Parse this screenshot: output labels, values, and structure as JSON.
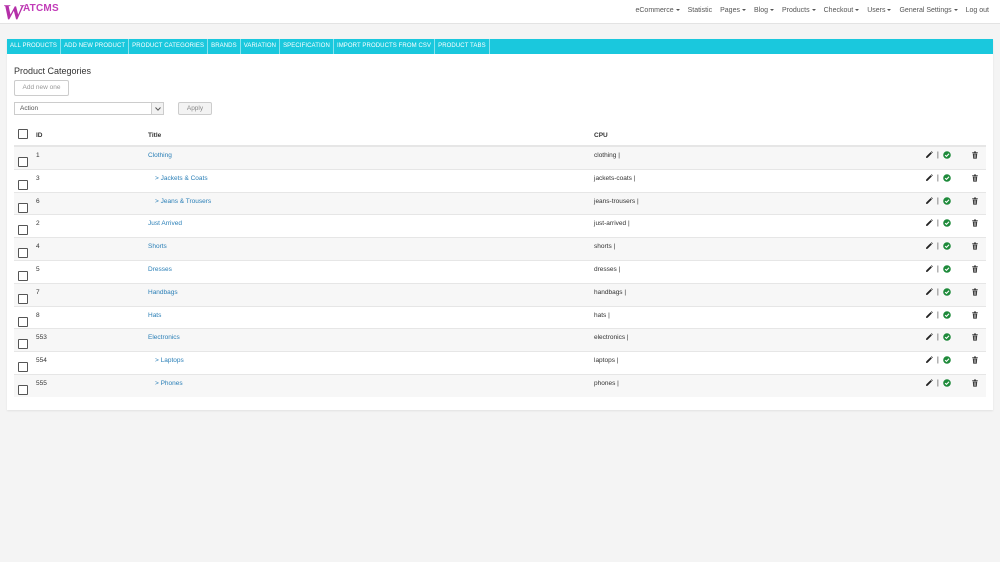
{
  "logo": {
    "letter": "W",
    "rest": "ATCMS"
  },
  "topnav": [
    {
      "label": "eCommerce",
      "caret": true
    },
    {
      "label": "Statistic",
      "caret": false
    },
    {
      "label": "Pages",
      "caret": true
    },
    {
      "label": "Blog",
      "caret": true
    },
    {
      "label": "Products",
      "caret": true
    },
    {
      "label": "Checkout",
      "caret": true
    },
    {
      "label": "Users",
      "caret": true
    },
    {
      "label": "General Settings",
      "caret": true
    },
    {
      "label": "Log out",
      "caret": false
    }
  ],
  "tabs": [
    "ALL PRODUCTS",
    "ADD NEW PRODUCT",
    "PRODUCT CATEGORIES",
    "BRANDS",
    "VARIATION",
    "SPECIFICATION",
    "IMPORT PRODUCTS FROM CSV",
    "PRODUCT TABS"
  ],
  "page": {
    "title": "Product Categories",
    "add_button": "Add new one",
    "action_select": "Action",
    "apply_button": "Apply"
  },
  "table": {
    "columns": {
      "id": "ID",
      "title": "Title",
      "cpu": "CPU"
    },
    "rows": [
      {
        "id": "1",
        "title": "Clothing",
        "child": false,
        "cpu": "clothing |"
      },
      {
        "id": "3",
        "title": "> Jackets & Coats",
        "child": true,
        "cpu": "jackets-coats |"
      },
      {
        "id": "6",
        "title": "> Jeans & Trousers",
        "child": true,
        "cpu": "jeans-trousers |"
      },
      {
        "id": "2",
        "title": "Just Arrived",
        "child": false,
        "cpu": "just-arrived |"
      },
      {
        "id": "4",
        "title": "Shorts",
        "child": false,
        "cpu": "shorts |"
      },
      {
        "id": "5",
        "title": "Dresses",
        "child": false,
        "cpu": "dresses |"
      },
      {
        "id": "7",
        "title": "Handbags",
        "child": false,
        "cpu": "handbags |"
      },
      {
        "id": "8",
        "title": "Hats",
        "child": false,
        "cpu": "hats |"
      },
      {
        "id": "553",
        "title": "Electronics",
        "child": false,
        "cpu": "electronics |"
      },
      {
        "id": "554",
        "title": "> Laptops",
        "child": true,
        "cpu": "laptops |"
      },
      {
        "id": "555",
        "title": "> Phones",
        "child": true,
        "cpu": "phones |"
      }
    ],
    "action_separator": "|"
  },
  "colors": {
    "accent": "#1ac8dd",
    "brand": "#b42fa8",
    "link": "#2a7fb7",
    "ok": "#1e8a3a"
  },
  "icons": {
    "edit": "pencil-icon",
    "status": "check-circle-icon",
    "delete": "trash-icon",
    "dropdown": "chevron-down-icon"
  }
}
